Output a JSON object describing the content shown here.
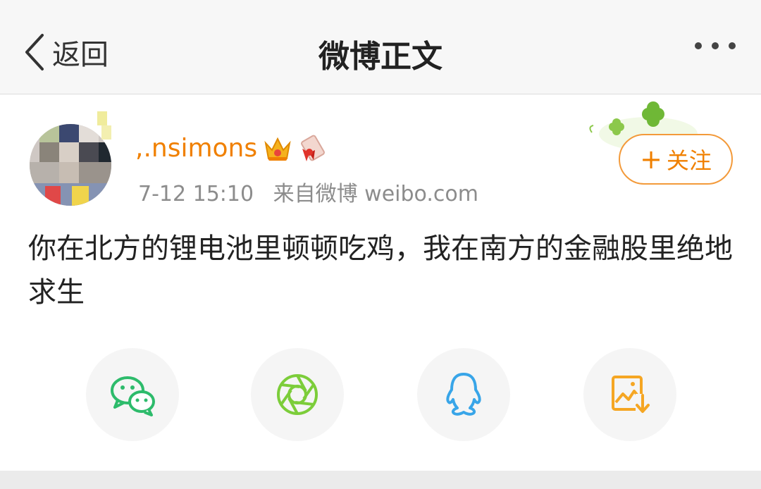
{
  "header": {
    "back_label": "返回",
    "title": "微博正文"
  },
  "author": {
    "username": ",.nsimons",
    "date": "7-12 15:10",
    "source": "来自微博 weibo.com",
    "follow_label": "关注",
    "follow_plus": "+"
  },
  "post": {
    "text": "你在北方的锂电池里顿顿吃鸡，我在南方的金融股里绝地求生"
  },
  "share": {
    "icons": [
      "wechat-icon",
      "moments-icon",
      "qq-icon",
      "save-image-icon"
    ]
  },
  "colors": {
    "accent_orange": "#f08000",
    "wechat_green": "#2dbb6b",
    "moments_green": "#7ccd3a",
    "qq_blue": "#38a5e8",
    "save_orange": "#f5a623"
  }
}
